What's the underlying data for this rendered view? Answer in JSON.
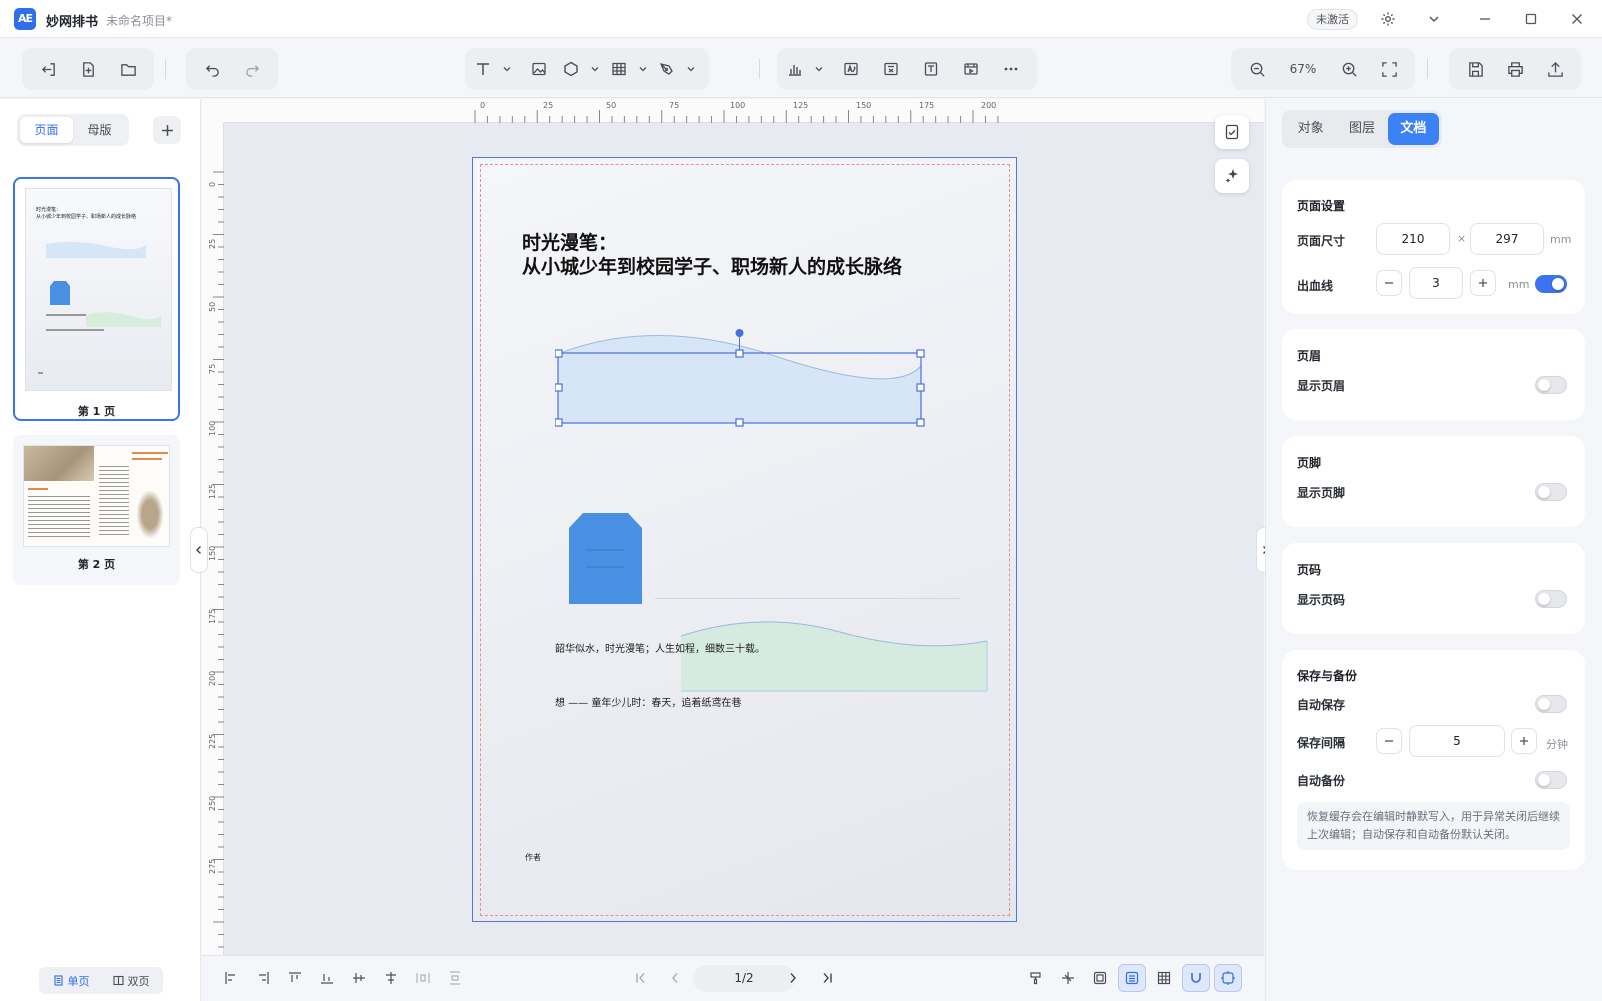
{
  "window": {
    "app_name": "妙网排书",
    "doc_title": "未命名项目*",
    "activate_label": "未激活"
  },
  "toolbar": {
    "zoom": "67%"
  },
  "left_panel": {
    "tabs": [
      "页面",
      "母版"
    ],
    "pages": [
      {
        "label": "第 1 页",
        "thumb_text": "时光漫笔：\n从小城少年到校园学子、职场新人的成长脉络"
      },
      {
        "label": "第 2 页"
      }
    ],
    "view_modes": [
      "单页",
      "双页"
    ]
  },
  "ruler": {
    "h_ticks": [
      "0",
      "25",
      "50",
      "75",
      "100",
      "125",
      "150",
      "175",
      "200"
    ],
    "v_ticks": [
      "0",
      "25",
      "50",
      "75",
      "100",
      "125",
      "150",
      "175",
      "200",
      "225",
      "250",
      "275"
    ]
  },
  "canvas": {
    "headline": "时光漫笔：\n从小城少年到校园学子、职场新人的成长脉络",
    "caption1": "韶华似水，时光漫笔；人生如程，细数三十载。",
    "caption2": "想 —— 童年少儿时：春天，追着纸鸢在巷",
    "author": "作者"
  },
  "bottom": {
    "pager": "1/2"
  },
  "right_panel": {
    "tabs": [
      "对象",
      "图层",
      "文档"
    ],
    "page_setup": {
      "title": "页面设置",
      "size_label": "页面尺寸",
      "width": "210",
      "times": "×",
      "height": "297",
      "unit": "mm",
      "bleed_label": "出血线",
      "bleed": "3",
      "bleed_unit": "mm",
      "bleed_on": true
    },
    "header": {
      "title": "页眉",
      "toggle_label": "显示页眉"
    },
    "footer": {
      "title": "页脚",
      "toggle_label": "显示页脚"
    },
    "page_number": {
      "title": "页码",
      "toggle_label": "显示页码"
    },
    "save": {
      "title": "保存与备份",
      "autosave_label": "自动保存",
      "interval_label": "保存间隔",
      "interval": "5",
      "interval_unit": "分钟",
      "backup_label": "自动备份",
      "note": "恢复缓存会在编辑时静默写入，用于异常关闭后继续上次编辑；自动保存和自动备份默认关闭。"
    }
  },
  "colors": {
    "accent": "#3b82f6",
    "page_border": "#5b73d6",
    "bleed_line": "#e88f96",
    "shape_blue": "#4a90e2"
  }
}
